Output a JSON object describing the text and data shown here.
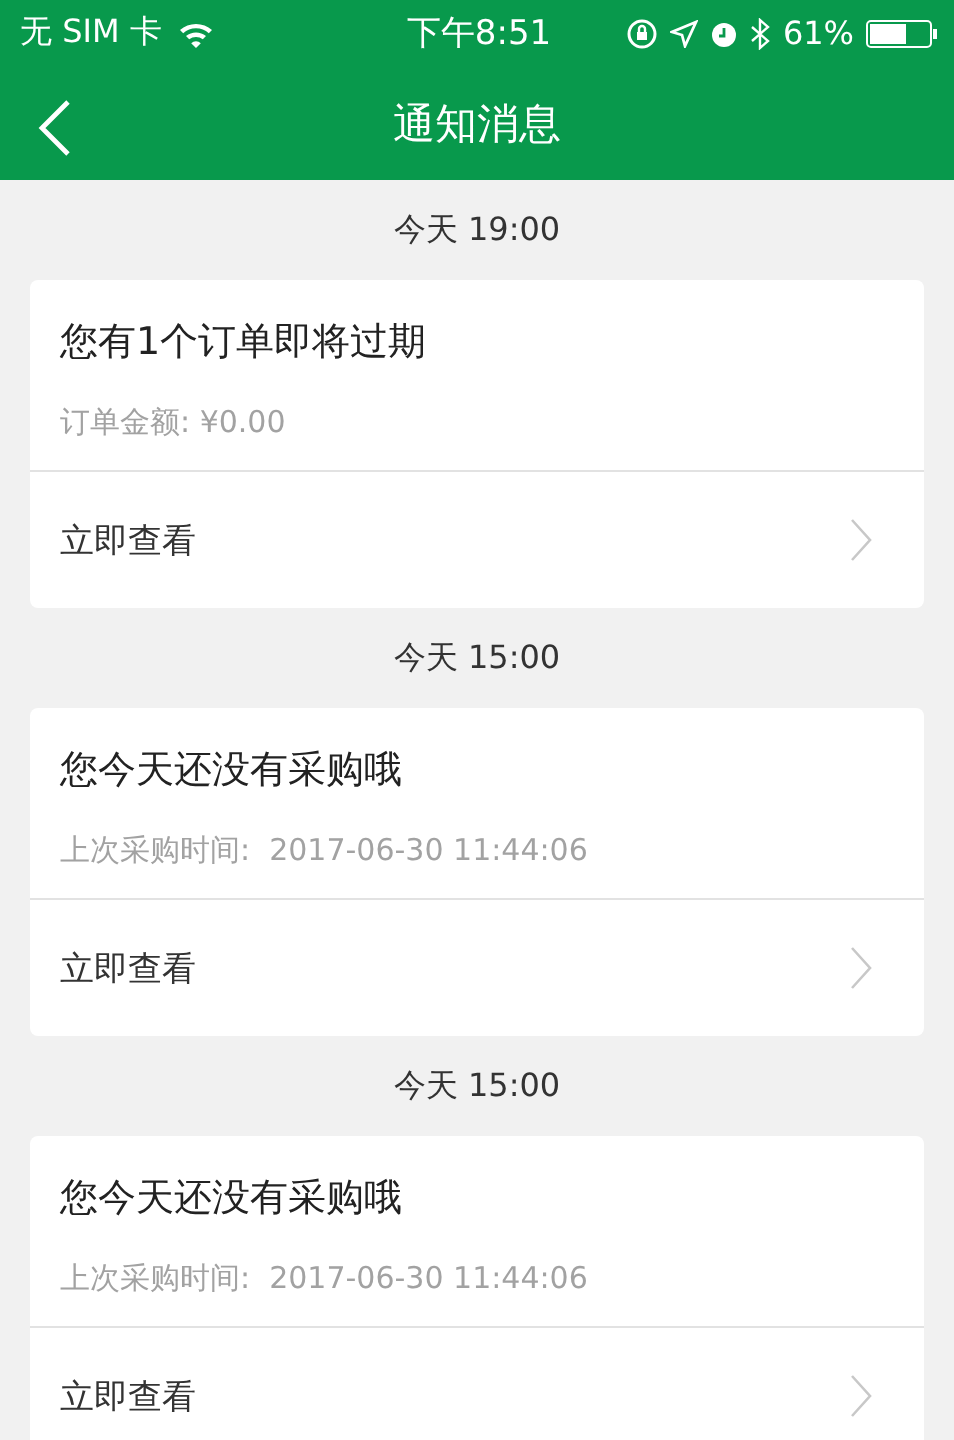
{
  "status_bar": {
    "carrier": "无 SIM 卡",
    "time": "下午8:51",
    "battery": "61%"
  },
  "nav_bar": {
    "title": "通知消息"
  },
  "notifications": [
    {
      "time": "今天 19:00",
      "title": "您有1个订单即将过期",
      "detail": "订单金额: ¥0.00",
      "action": "立即查看"
    },
    {
      "time": "今天 15:00",
      "title": "您今天还没有采购哦",
      "detail": "上次采购时间:  2017-06-30 11:44:06",
      "action": "立即查看"
    },
    {
      "time": "今天 15:00",
      "title": "您今天还没有采购哦",
      "detail": "上次采购时间:  2017-06-30 11:44:06",
      "action": "立即查看"
    }
  ]
}
